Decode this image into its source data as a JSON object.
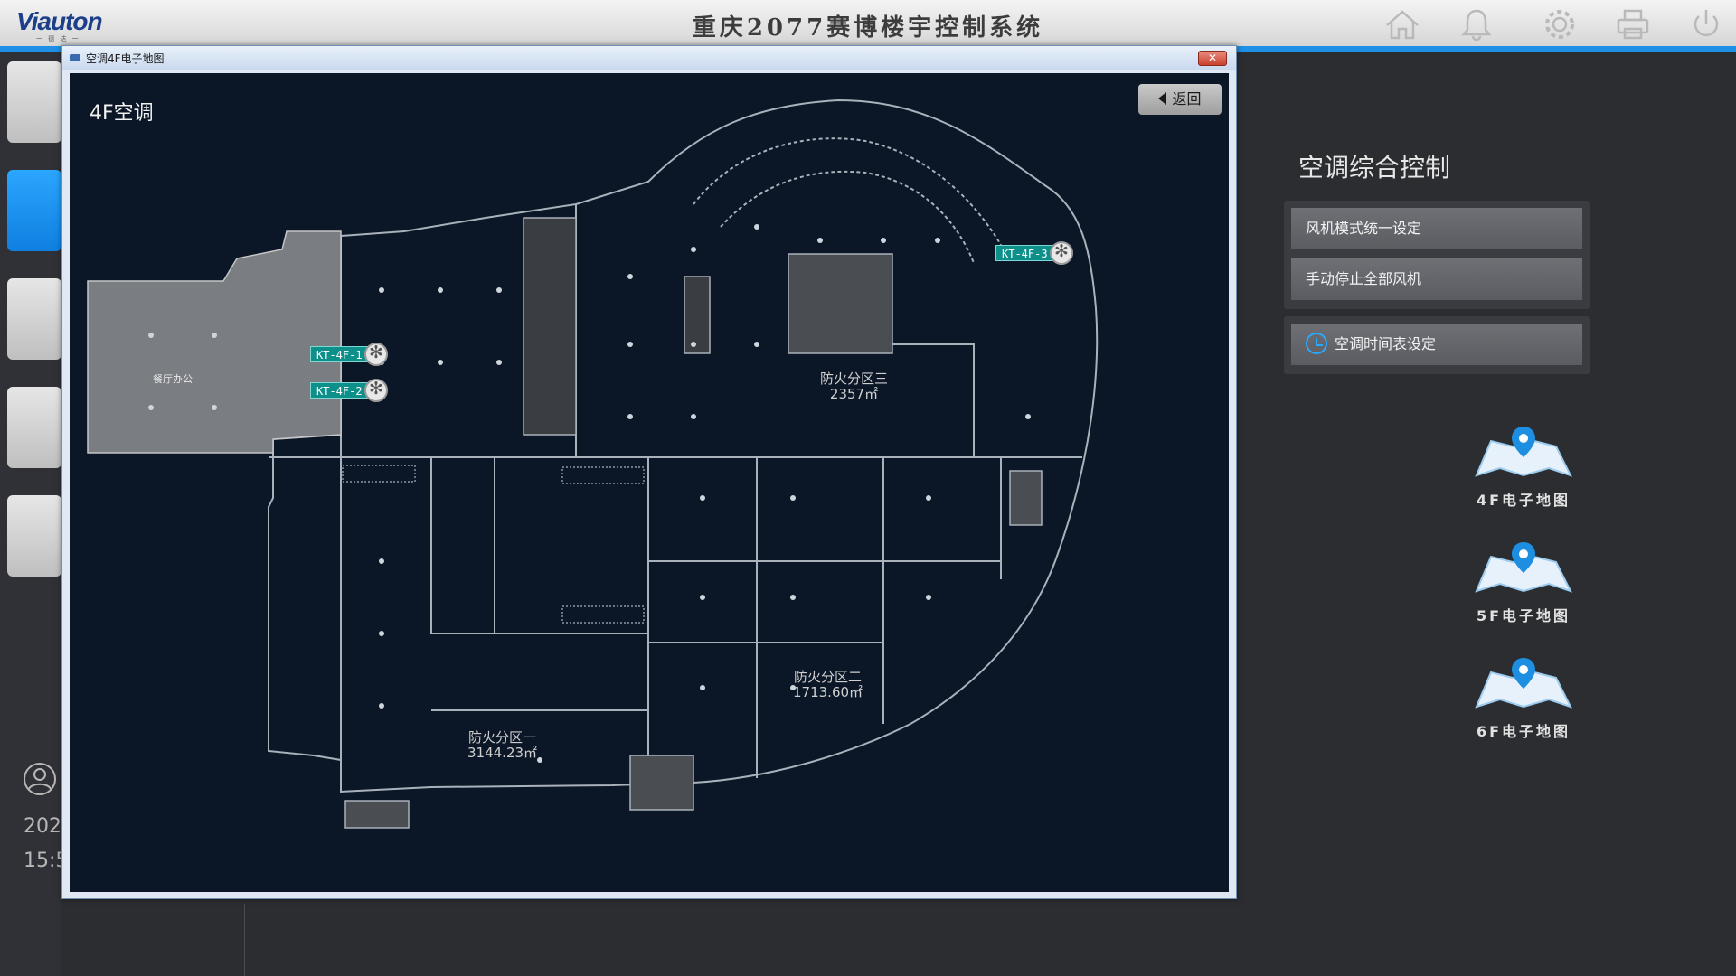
{
  "header": {
    "logo": "Viauton",
    "logo_sub": "一 德 达 一",
    "title": "重庆2077赛博楼宇控制系统",
    "icons": [
      "home-icon",
      "bell-icon",
      "gear-icon",
      "printer-icon",
      "power-icon"
    ]
  },
  "sidebar": {
    "date_text": "202",
    "time_text": "15:5"
  },
  "popup": {
    "window_title": "空调4F电子地图",
    "close_label": "✕",
    "floor_label": "4F空调",
    "back_label": "返回",
    "units": [
      {
        "id": "KT-4F-1"
      },
      {
        "id": "KT-4F-2"
      },
      {
        "id": "KT-4F-3"
      }
    ],
    "zones": [
      {
        "name": "防火分区三",
        "area": "2357㎡"
      },
      {
        "name": "防火分区二",
        "area": "1713.60㎡"
      },
      {
        "name": "防火分区一",
        "area": "3144.23㎡"
      }
    ],
    "room_label": "餐厅办公"
  },
  "panel": {
    "heading": "空调综合控制",
    "buttons": {
      "fan_mode": "风机模式统一设定",
      "stop_all": "手动停止全部风机",
      "schedule": "空调时间表设定"
    },
    "maps": [
      {
        "label": "4F电子地图"
      },
      {
        "label": "5F电子地图"
      },
      {
        "label": "6F电子地图"
      }
    ]
  },
  "colors": {
    "accent": "#1e90e6",
    "map_background": "#0b1626",
    "unit_tag": "#0d8f8a"
  }
}
